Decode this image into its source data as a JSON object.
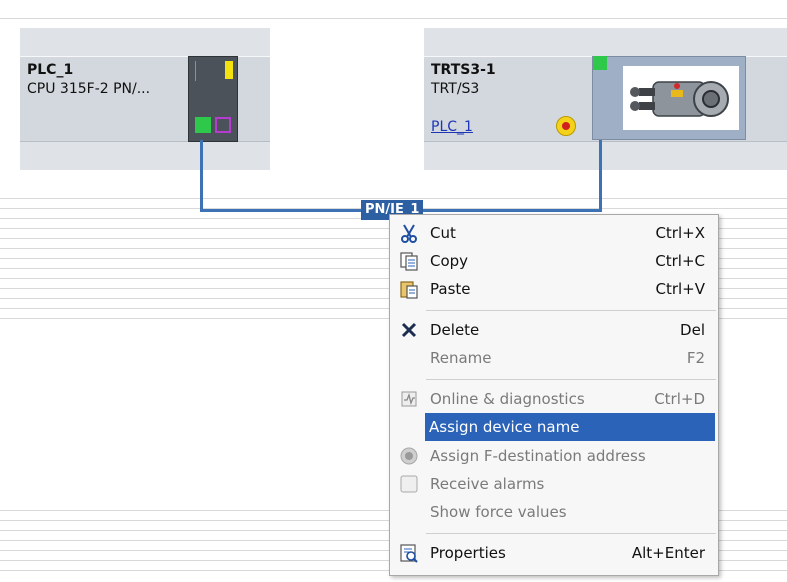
{
  "devices": {
    "plc": {
      "name": "PLC_1",
      "type": "CPU 315F-2 PN/..."
    },
    "trts": {
      "name": "TRTS3-1",
      "type": "TRT/S3",
      "link": "PLC_1"
    }
  },
  "network": {
    "label": "PN/IE_1"
  },
  "context_menu": {
    "items": [
      {
        "label": "Cut",
        "shortcut": "Ctrl+X",
        "icon": "scissors-icon",
        "enabled": true
      },
      {
        "label": "Copy",
        "shortcut": "Ctrl+C",
        "icon": "copy-icon",
        "enabled": true
      },
      {
        "label": "Paste",
        "shortcut": "Ctrl+V",
        "icon": "paste-icon",
        "enabled": true
      },
      {
        "label": "Delete",
        "shortcut": "Del",
        "icon": "delete-x-icon",
        "enabled": true
      },
      {
        "label": "Rename",
        "shortcut": "F2",
        "enabled": false
      },
      {
        "label": "Online & diagnostics",
        "shortcut": "Ctrl+D",
        "icon": "diagnostics-icon",
        "enabled": false
      },
      {
        "label": "Assign device name",
        "shortcut": "",
        "enabled": true,
        "selected": true
      },
      {
        "label": "Assign F-destination address",
        "shortcut": "",
        "icon": "f-address-icon",
        "enabled": false
      },
      {
        "label": "Receive alarms",
        "shortcut": "",
        "icon": "checkbox-icon",
        "enabled": false
      },
      {
        "label": "Show force values",
        "shortcut": "",
        "enabled": false
      },
      {
        "label": "Properties",
        "shortcut": "Alt+Enter",
        "icon": "properties-icon",
        "enabled": true
      }
    ]
  },
  "colors": {
    "selection": "#2a63b8",
    "network": "#3d73b5",
    "status_green": "#2ec84a"
  }
}
